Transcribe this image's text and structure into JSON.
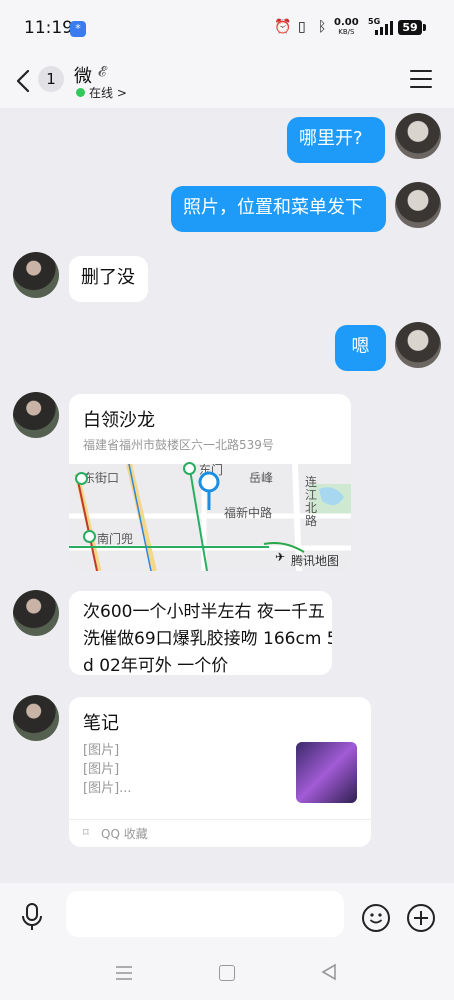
{
  "status_bar": {
    "time": "11:19",
    "app_badge": "*",
    "net_speed_value": "0.00",
    "net_speed_unit": "KB/S",
    "signal_label": "5G",
    "battery": "59"
  },
  "header": {
    "unread_count": "1",
    "contact_name": "微",
    "online_status": "在线 >"
  },
  "messages": [
    {
      "from": "me",
      "text": "哪里开?"
    },
    {
      "from": "me",
      "text": "照片，位置和菜单发下"
    },
    {
      "from": "peer",
      "text": "删了没"
    },
    {
      "from": "me",
      "text": "嗯"
    },
    {
      "from": "peer",
      "type": "location"
    },
    {
      "from": "peer",
      "text_line1": "次600一个小时半左右 夜一千五",
      "text_line2": "洗催做69口爆乳胶接吻 166cm 5",
      "text_line3": "d 02年可外 一个价"
    },
    {
      "from": "peer",
      "type": "note"
    }
  ],
  "location": {
    "title": "白领沙龙",
    "address": "福建省福州市鼓楼区六一北路539号",
    "map_labels": {
      "street1": "东街口",
      "street2": "东门",
      "street3": "岳峰",
      "street4": "福新中路",
      "street5": "连江北路",
      "street6": "南门兜",
      "brand": "腾讯地图"
    }
  },
  "note": {
    "title": "笔记",
    "lines": [
      "[图片]",
      "[图片]",
      "[图片]..."
    ],
    "source": "QQ 收藏"
  },
  "input": {
    "placeholder": ""
  },
  "colors": {
    "bubble_blue": "#1e9bf8",
    "background": "#ededf1",
    "online": "#35c759"
  }
}
